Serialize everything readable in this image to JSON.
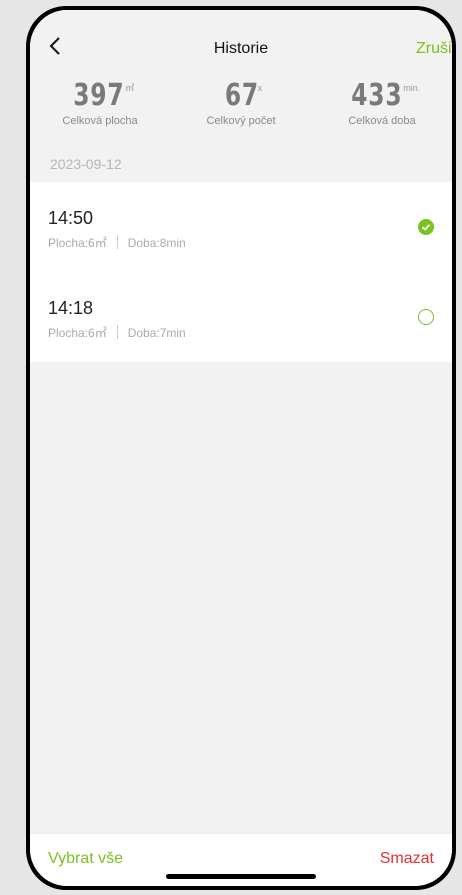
{
  "header": {
    "title": "Historie",
    "cancel_label": "Zrušit"
  },
  "stats": [
    {
      "value": "397",
      "unit": "㎡",
      "label": "Celková plocha"
    },
    {
      "value": "67",
      "unit": "x",
      "label": "Celkový počet"
    },
    {
      "value": "433",
      "unit": "min.",
      "label": "Celková doba"
    }
  ],
  "date_group": "2023-09-12",
  "records": [
    {
      "time": "14:50",
      "area": "Plocha:6㎡",
      "duration": "Doba:8min",
      "selected": true
    },
    {
      "time": "14:18",
      "area": "Plocha:6㎡",
      "duration": "Doba:7min",
      "selected": false
    }
  ],
  "footer": {
    "select_all_label": "Vybrat vše",
    "delete_label": "Smazat"
  },
  "colors": {
    "accent": "#7ac21f",
    "danger": "#e62e2e"
  }
}
